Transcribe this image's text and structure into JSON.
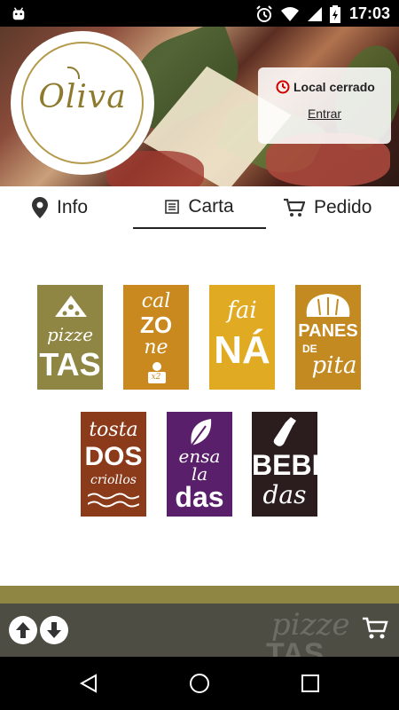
{
  "status_bar": {
    "time": "17:03",
    "icons": [
      "android-icon",
      "alarm-icon",
      "wifi-icon",
      "signal-icon",
      "battery-icon"
    ]
  },
  "hero": {
    "logo_text": "Oliva",
    "status_text": "Local cerrado",
    "enter_label": "Entrar"
  },
  "tabs": [
    {
      "label": "Info",
      "icon": "location-icon",
      "selected": false
    },
    {
      "label": "Carta",
      "icon": "list-icon",
      "selected": true
    },
    {
      "label": "Pedido",
      "icon": "cart-icon",
      "selected": false
    }
  ],
  "menu": [
    {
      "lines": [
        "pizze",
        "TAS"
      ],
      "color": "#8f8644"
    },
    {
      "lines": [
        "cal",
        "ZO",
        "ne",
        "x2"
      ],
      "color": "#c9891e"
    },
    {
      "lines": [
        "fai",
        "NÁ"
      ],
      "color": "#e0ab22"
    },
    {
      "lines": [
        "PANES",
        "DE",
        "pita"
      ],
      "color": "#c48a22"
    },
    {
      "lines": [
        "tosta",
        "DOS",
        "criollos"
      ],
      "color": "#8b3a1a"
    },
    {
      "lines": [
        "ensa",
        "la",
        "das"
      ],
      "color": "#5a1f6b"
    },
    {
      "lines": [
        "BEBI",
        "das"
      ],
      "color": "#2b1d1d"
    }
  ],
  "bottom_bar": {
    "ghost_lines": [
      "pizze",
      "TAS"
    ]
  },
  "colors": {
    "olive": "#8f8644",
    "closed_red": "#d00000",
    "bottom_bar": "#4d4d44"
  }
}
